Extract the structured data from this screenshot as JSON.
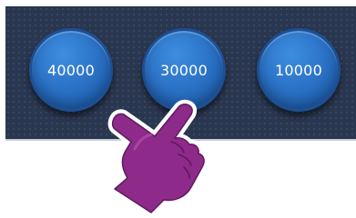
{
  "buttons": [
    {
      "label": "40000"
    },
    {
      "label": "30000"
    },
    {
      "label": "10000"
    }
  ],
  "colors": {
    "strip_background": "#2a3750",
    "button_fill": "#2c74c8",
    "button_border": "#1d4f94",
    "hand_fill": "#8e2a8a",
    "hand_outline": "#ffffff"
  },
  "icons": {
    "pointer": "pointing-hand-icon"
  }
}
